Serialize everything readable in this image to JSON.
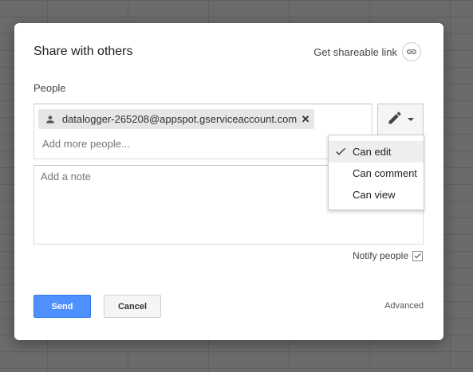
{
  "dialog": {
    "title": "Share with others",
    "shareable_link_label": "Get shareable link",
    "people_label": "People",
    "chip_email": "datalogger-265208@appspot.gserviceaccount.com",
    "add_more_placeholder": "Add more people...",
    "note_placeholder": "Add a note",
    "notify_label": "Notify people",
    "notify_checked": true,
    "send_label": "Send",
    "cancel_label": "Cancel",
    "advanced_label": "Advanced"
  },
  "permission_menu": {
    "items": [
      {
        "label": "Can edit",
        "selected": true
      },
      {
        "label": "Can comment",
        "selected": false
      },
      {
        "label": "Can view",
        "selected": false
      }
    ]
  },
  "colors": {
    "send_button": "#4d90fe",
    "backdrop": "#6b6b6b"
  },
  "icons": [
    "link-icon",
    "person-icon",
    "close-icon",
    "pencil-icon",
    "chevron-down-icon",
    "check-icon"
  ]
}
